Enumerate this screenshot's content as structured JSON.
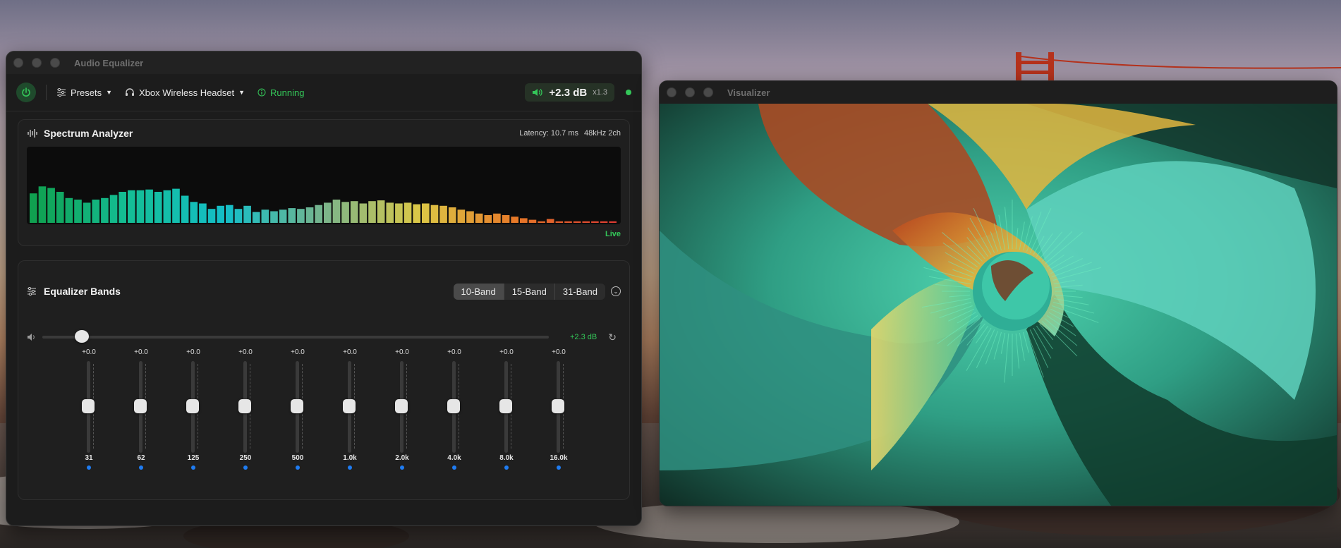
{
  "eq_window": {
    "title": "Audio Equalizer",
    "toolbar": {
      "presets_label": "Presets",
      "device_label": "Xbox Wireless Headset",
      "status_label": "Running",
      "gain_value": "+2.3 dB",
      "gain_multiplier": "x1.3"
    },
    "spectrum": {
      "title": "Spectrum Analyzer",
      "latency": "Latency: 10.7 ms",
      "format": "48kHz 2ch",
      "live_label": "Live",
      "levels": [
        0.38,
        0.47,
        0.45,
        0.4,
        0.32,
        0.3,
        0.26,
        0.3,
        0.32,
        0.36,
        0.4,
        0.42,
        0.42,
        0.43,
        0.4,
        0.42,
        0.44,
        0.35,
        0.27,
        0.25,
        0.18,
        0.22,
        0.23,
        0.18,
        0.22,
        0.14,
        0.17,
        0.15,
        0.17,
        0.19,
        0.18,
        0.2,
        0.23,
        0.26,
        0.3,
        0.27,
        0.28,
        0.25,
        0.28,
        0.29,
        0.26,
        0.25,
        0.26,
        0.24,
        0.25,
        0.23,
        0.22,
        0.2,
        0.17,
        0.15,
        0.12,
        0.1,
        0.12,
        0.1,
        0.08,
        0.06,
        0.04,
        0.02,
        0.05,
        0.02,
        0.02,
        0.02,
        0.02,
        0.02,
        0.02,
        0.02
      ]
    },
    "bands": {
      "title": "Equalizer Bands",
      "modes": [
        "10-Band",
        "15-Band",
        "31-Band"
      ],
      "active_mode": "10-Band",
      "preamp_value": "+2.3 dB",
      "items": [
        {
          "freq": "31",
          "value": "+0.0"
        },
        {
          "freq": "62",
          "value": "+0.0"
        },
        {
          "freq": "125",
          "value": "+0.0"
        },
        {
          "freq": "250",
          "value": "+0.0"
        },
        {
          "freq": "500",
          "value": "+0.0"
        },
        {
          "freq": "1.0k",
          "value": "+0.0"
        },
        {
          "freq": "2.0k",
          "value": "+0.0"
        },
        {
          "freq": "4.0k",
          "value": "+0.0"
        },
        {
          "freq": "8.0k",
          "value": "+0.0"
        },
        {
          "freq": "16.0k",
          "value": "+0.0"
        }
      ]
    }
  },
  "viz_window": {
    "title": "Visualizer"
  },
  "colors": {
    "accent_green": "#34c759",
    "band_dot": "#1f7cf2"
  }
}
